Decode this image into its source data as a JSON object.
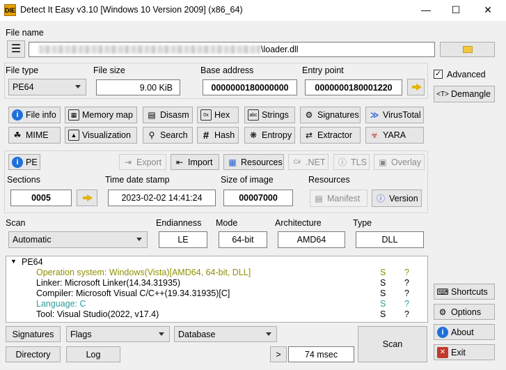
{
  "window": {
    "title": "Detect It Easy v3.10 [Windows 10 Version 2009] (x86_64)",
    "logo": "DIE",
    "controls": {
      "minimize": "—",
      "maximize": "☐",
      "close": "✕"
    }
  },
  "file": {
    "label": "File name",
    "path_visible_suffix": "\\loader.dll"
  },
  "fields": {
    "file_type_label": "File type",
    "file_type_value": "PE64",
    "file_size_label": "File size",
    "file_size_value": "9.00 KiB",
    "base_address_label": "Base address",
    "base_address_value": "0000000180000000",
    "entry_point_label": "Entry point",
    "entry_point_value": "0000000180001220"
  },
  "tools_row1": [
    "File info",
    "Memory map",
    "Disasm",
    "Hex",
    "Strings",
    "Signatures",
    "VirusTotal"
  ],
  "tools_row2": [
    "MIME",
    "Visualization",
    "Search",
    "Hash",
    "Entropy",
    "Extractor",
    "YARA"
  ],
  "pe": {
    "pe_button": "PE",
    "export": "Export",
    "import": "Import",
    "resources": "Resources",
    "net": ".NET",
    "tls": "TLS",
    "overlay": "Overlay",
    "sections_label": "Sections",
    "sections_value": "0005",
    "timestamp_label": "Time date stamp",
    "timestamp_value": "2023-02-02 14:41:24",
    "size_of_image_label": "Size of image",
    "size_of_image_value": "00007000",
    "resources_label": "Resources",
    "manifest": "Manifest",
    "version": "Version"
  },
  "scan": {
    "scan_label": "Scan",
    "scan_value": "Automatic",
    "endianness_label": "Endianness",
    "endianness_value": "LE",
    "mode_label": "Mode",
    "mode_value": "64-bit",
    "architecture_label": "Architecture",
    "architecture_value": "AMD64",
    "type_label": "Type",
    "type_value": "DLL"
  },
  "results": {
    "root": "PE64",
    "lines": [
      {
        "text": "Operation system: Windows(Vista)[AMD64, 64-bit, DLL]",
        "s": "S",
        "q": "?",
        "color": "#8f8f00"
      },
      {
        "text": "Linker: Microsoft Linker(14.34.31935)",
        "s": "S",
        "q": "?",
        "color": "#000000"
      },
      {
        "text": "Compiler: Microsoft Visual C/C++(19.34.31935)[C]",
        "s": "S",
        "q": "?",
        "color": "#000000"
      },
      {
        "text": "Language: C",
        "s": "S",
        "q": "?",
        "color": "#2e9b9b"
      },
      {
        "text": "Tool: Visual Studio(2022, v17.4)",
        "s": "S",
        "q": "?",
        "color": "#000000"
      }
    ]
  },
  "right_panel": {
    "advanced": "Advanced",
    "advanced_checked": true,
    "demangle": "Demangle",
    "shortcuts": "Shortcuts",
    "options": "Options",
    "about": "About",
    "exit": "Exit"
  },
  "bottom": {
    "signatures": "Signatures",
    "flags": "Flags",
    "database": "Database",
    "directory": "Directory",
    "log": "Log",
    "more": ">",
    "time": "74 msec",
    "scan": "Scan"
  }
}
